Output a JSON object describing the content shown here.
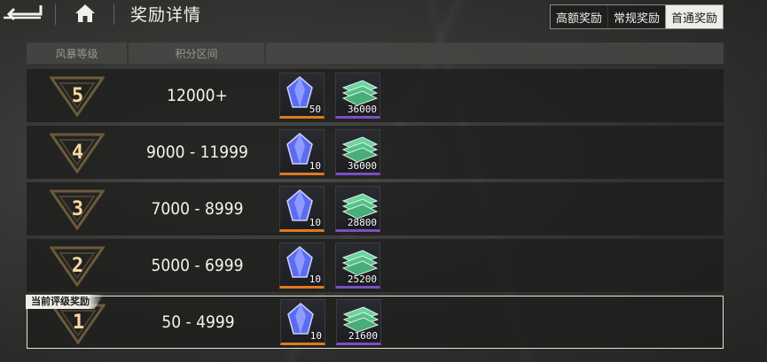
{
  "header": {
    "title": "奖励详情",
    "back_icon": "back-arrow-icon",
    "home_icon": "home-icon",
    "tabs": [
      {
        "label": "高额奖励",
        "active": false
      },
      {
        "label": "常规奖励",
        "active": false
      },
      {
        "label": "首通奖励",
        "active": true
      }
    ]
  },
  "table": {
    "columns": [
      "风暴等级",
      "积分区间",
      ""
    ],
    "current_label": "当前评级奖励",
    "rows": [
      {
        "rank": "5",
        "range": "12000+",
        "rewards": [
          {
            "icon": "crystal-icon",
            "qty": "50",
            "rarity": "orange"
          },
          {
            "icon": "cash-stack-icon",
            "qty": "36000",
            "rarity": "purple"
          }
        ]
      },
      {
        "rank": "4",
        "range": "9000 - 11999",
        "rewards": [
          {
            "icon": "crystal-icon",
            "qty": "10",
            "rarity": "orange"
          },
          {
            "icon": "cash-stack-icon",
            "qty": "36000",
            "rarity": "purple"
          }
        ]
      },
      {
        "rank": "3",
        "range": "7000 - 8999",
        "rewards": [
          {
            "icon": "crystal-icon",
            "qty": "10",
            "rarity": "orange"
          },
          {
            "icon": "cash-stack-icon",
            "qty": "28800",
            "rarity": "purple"
          }
        ]
      },
      {
        "rank": "2",
        "range": "5000 - 6999",
        "rewards": [
          {
            "icon": "crystal-icon",
            "qty": "10",
            "rarity": "orange"
          },
          {
            "icon": "cash-stack-icon",
            "qty": "25200",
            "rarity": "purple"
          }
        ]
      },
      {
        "rank": "1",
        "range": "50 - 4999",
        "rewards": [
          {
            "icon": "crystal-icon",
            "qty": "10",
            "rarity": "orange"
          },
          {
            "icon": "cash-stack-icon",
            "qty": "21600",
            "rarity": "purple"
          }
        ]
      }
    ]
  },
  "colors": {
    "rank_gold": "#f6d9a3",
    "rarity_orange": "#e07a1e",
    "rarity_purple": "#7b4fc4",
    "active_tab_bg": "#efedea"
  }
}
